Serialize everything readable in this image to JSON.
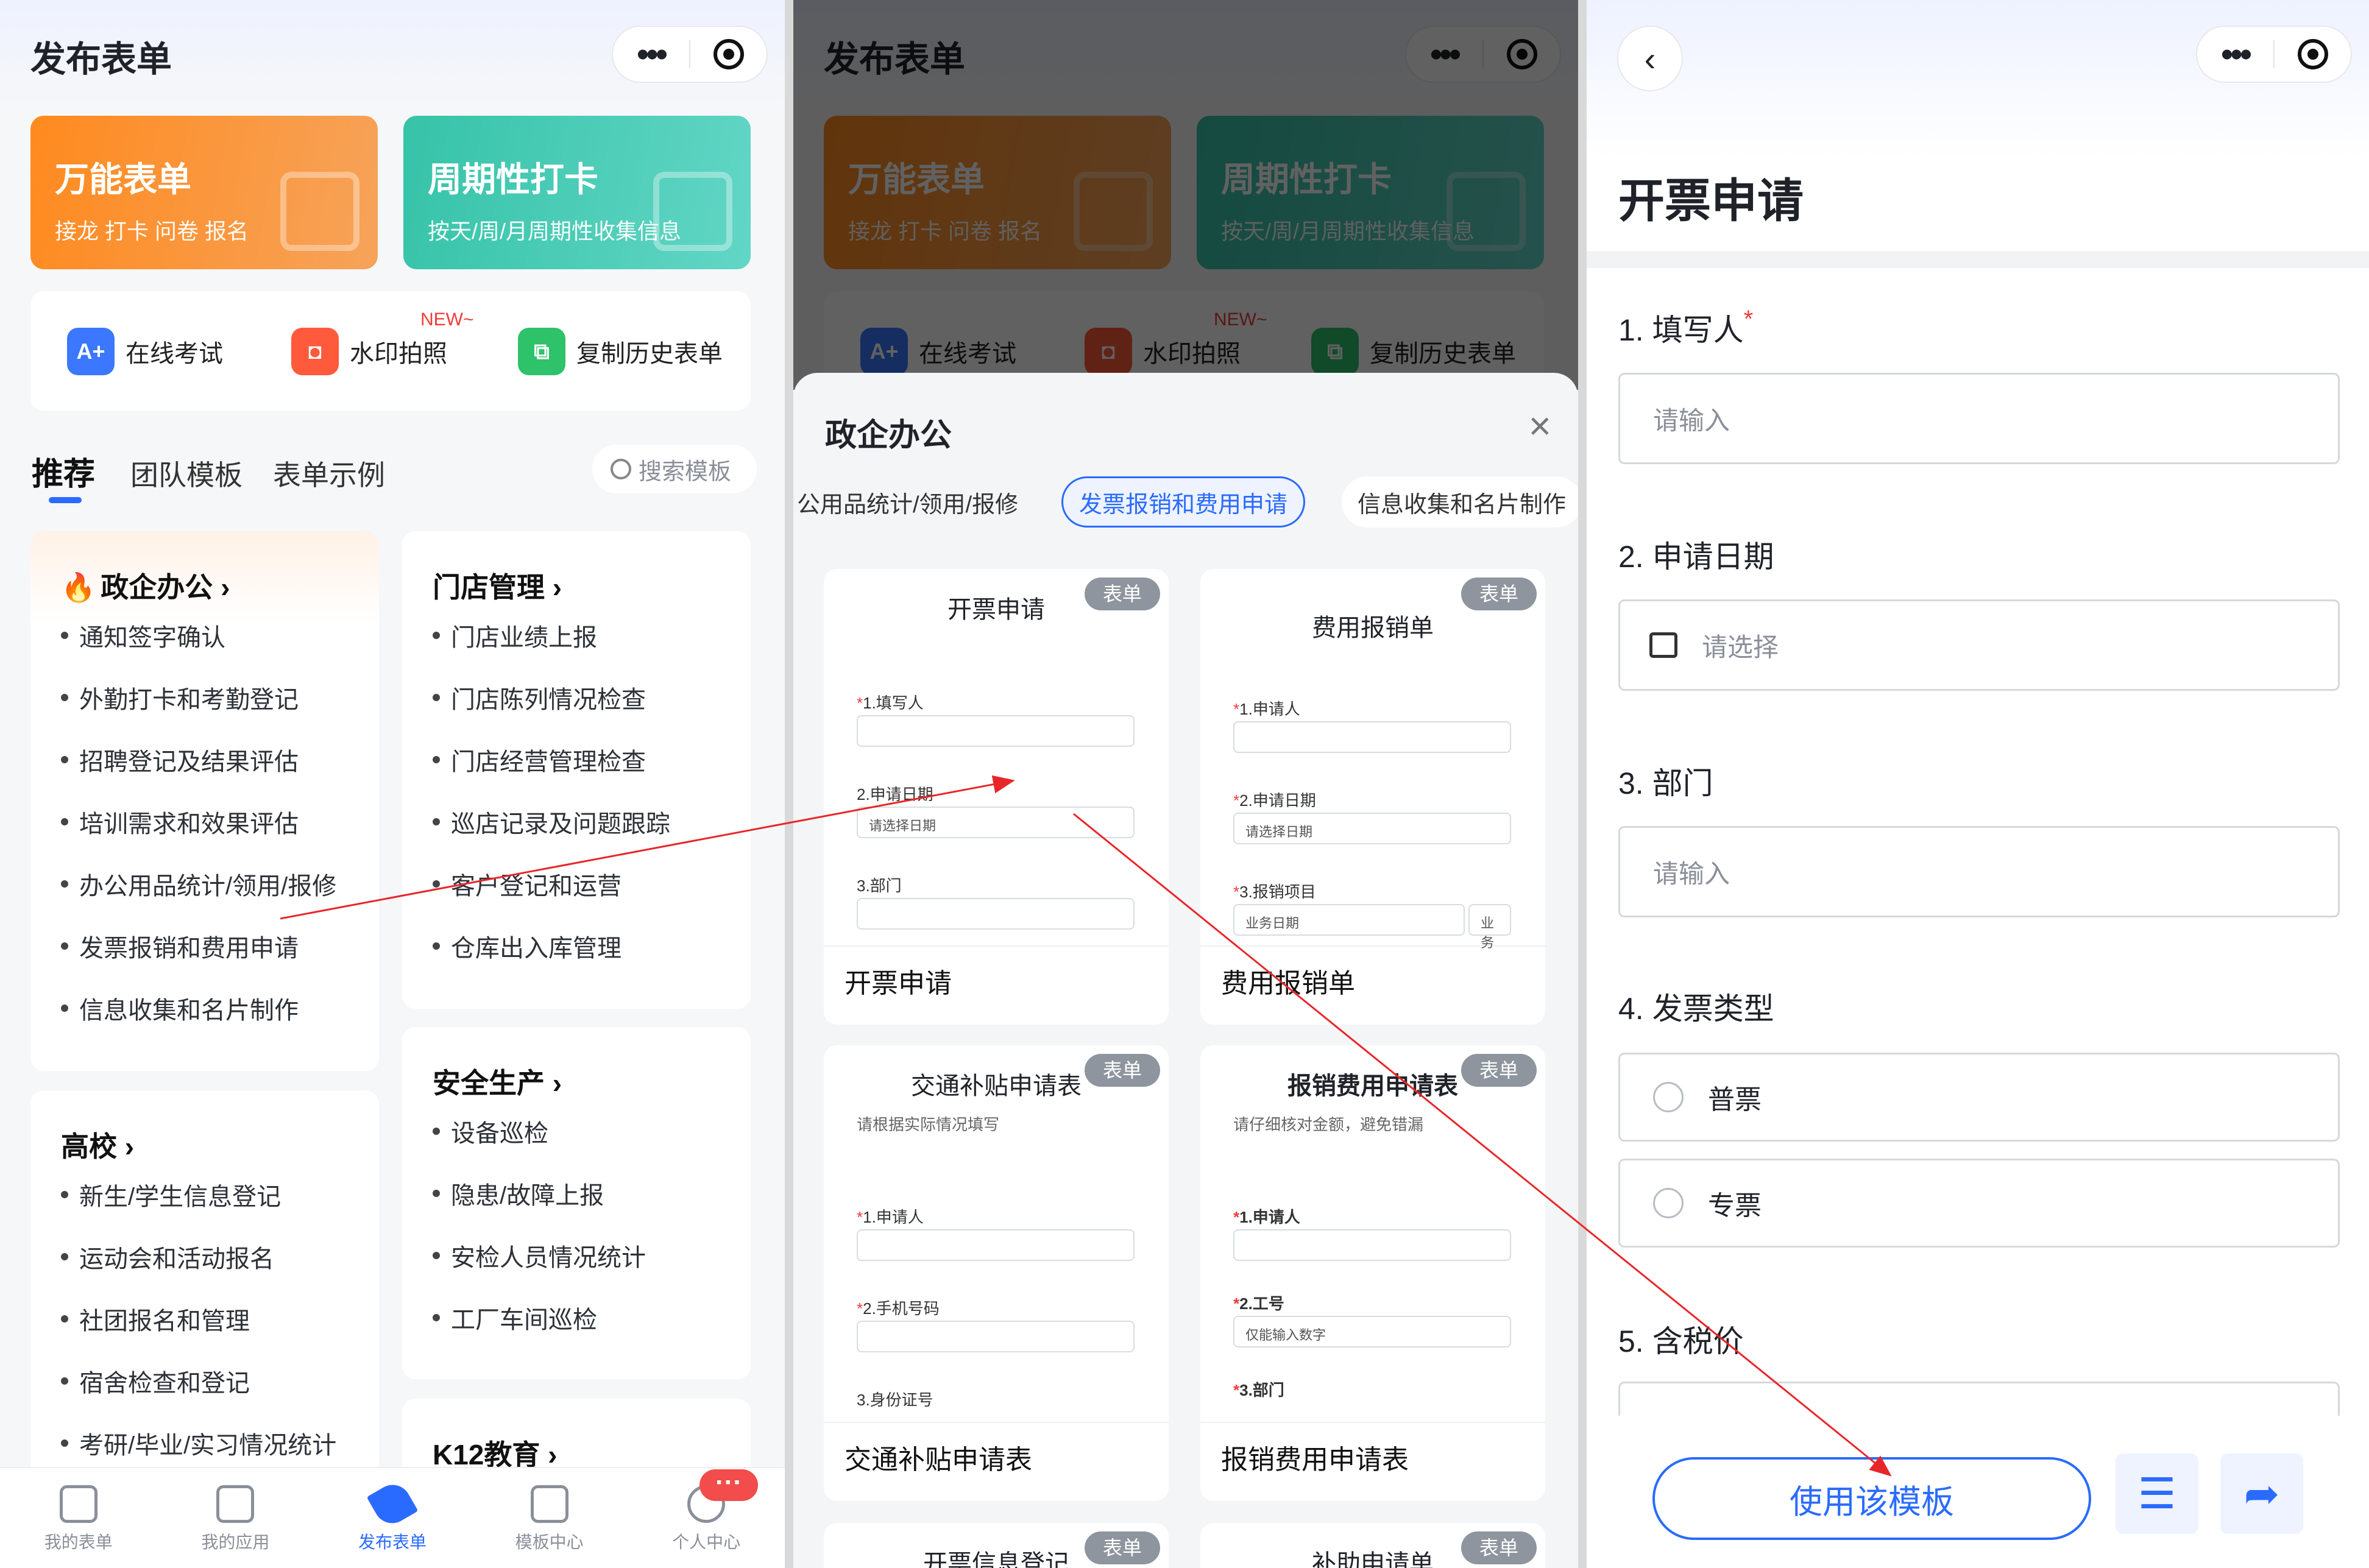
{
  "panel1": {
    "title": "发布表单",
    "cards": [
      {
        "title": "万能表单",
        "sub": "接龙 打卡 问卷 报名"
      },
      {
        "title": "周期性打卡",
        "sub": "按天/周/月周期性收集信息"
      }
    ],
    "quick": [
      {
        "label": "在线考试",
        "icon": "A+"
      },
      {
        "label": "水印拍照",
        "icon": "◘",
        "badge": "NEW~"
      },
      {
        "label": "复制历史表单",
        "icon": "⧉"
      }
    ],
    "tabs": [
      "推荐",
      "团队模板",
      "表单示例"
    ],
    "search_placeholder": "搜索模板",
    "categories": [
      {
        "name": "政企办公",
        "items": [
          "通知签字确认",
          "外勤打卡和考勤登记",
          "招聘登记及结果评估",
          "培训需求和效果评估",
          "办公用品统计/领用/报修",
          "发票报销和费用申请",
          "信息收集和名片制作"
        ]
      },
      {
        "name": "门店管理",
        "items": [
          "门店业绩上报",
          "门店陈列情况检查",
          "门店经营管理检查",
          "巡店记录及问题跟踪",
          "客户登记和运营",
          "仓库出入库管理"
        ]
      },
      {
        "name": "高校",
        "items": [
          "新生/学生信息登记",
          "运动会和活动报名",
          "社团报名和管理",
          "宿舍检查和登记",
          "考研/毕业/实习情况统计"
        ]
      },
      {
        "name": "安全生产",
        "items": [
          "设备巡检",
          "隐患/故障上报",
          "安检人员情况统计",
          "工厂车间巡检"
        ]
      },
      {
        "name": "K12教育",
        "items": []
      }
    ],
    "tabbar": [
      {
        "label": "我的表单"
      },
      {
        "label": "我的应用"
      },
      {
        "label": "发布表单"
      },
      {
        "label": "模板中心"
      },
      {
        "label": "个人中心"
      }
    ],
    "badge": "···",
    "chevron": "›"
  },
  "panel2": {
    "sheet_title": "政企办公",
    "close": "×",
    "chips": [
      "公用品统计/领用/报修",
      "发票报销和费用申请",
      "信息收集和名片制作"
    ],
    "tag": "表单",
    "templates": [
      {
        "title": "开票申请",
        "name": "开票申请",
        "fields": [
          {
            "label": "1.填写人",
            "req": "*"
          },
          {
            "label": "2.申请日期",
            "req": "",
            "value": "请选择日期"
          },
          {
            "label": "3.部门",
            "req": ""
          }
        ]
      },
      {
        "title": "费用报销单",
        "name": "费用报销单",
        "fields": [
          {
            "label": "1.申请人",
            "req": "*"
          },
          {
            "label": "2.申请日期",
            "req": "*",
            "value": "请选择日期"
          },
          {
            "label": "3.报销项目",
            "req": "*",
            "value": "业务日期"
          }
        ],
        "extra": "业务"
      },
      {
        "title": "交通补贴申请表",
        "name": "交通补贴申请表",
        "desc": "请根据实际情况填写",
        "fields": [
          {
            "label": "1.申请人",
            "req": "*"
          },
          {
            "label": "2.手机号码",
            "req": "*"
          },
          {
            "label": "3.身份证号",
            "req": ""
          }
        ]
      },
      {
        "title": "报销费用申请表",
        "name": "报销费用申请表",
        "desc": "请仔细核对金额，避免错漏",
        "fields": [
          {
            "label": "1.申请人",
            "req": "*"
          },
          {
            "label": "2.工号",
            "req": "*",
            "value": "仅能输入数字"
          },
          {
            "label": "3.部门",
            "req": "*"
          }
        ]
      }
    ],
    "more": [
      "开票信息登记",
      "补助申请单"
    ]
  },
  "panel3": {
    "back": "‹",
    "title": "开票申请",
    "questions": [
      {
        "label": "1. 填写人",
        "req": "*",
        "placeholder": "请输入"
      },
      {
        "label": "2. 申请日期",
        "req": "",
        "placeholder": "请选择"
      },
      {
        "label": "3. 部门",
        "req": "",
        "placeholder": "请输入"
      },
      {
        "label": "4. 发票类型",
        "req": "",
        "options": [
          "普票",
          "专票"
        ]
      },
      {
        "label": "5. 含税价",
        "req": ""
      }
    ],
    "use_button": "使用该模板",
    "menu_icon": "☰",
    "share_icon": "➦"
  },
  "colors": {
    "accent": "#2a6bff",
    "annotation_arrow": "#e8262a",
    "required": "#f23b3b"
  }
}
